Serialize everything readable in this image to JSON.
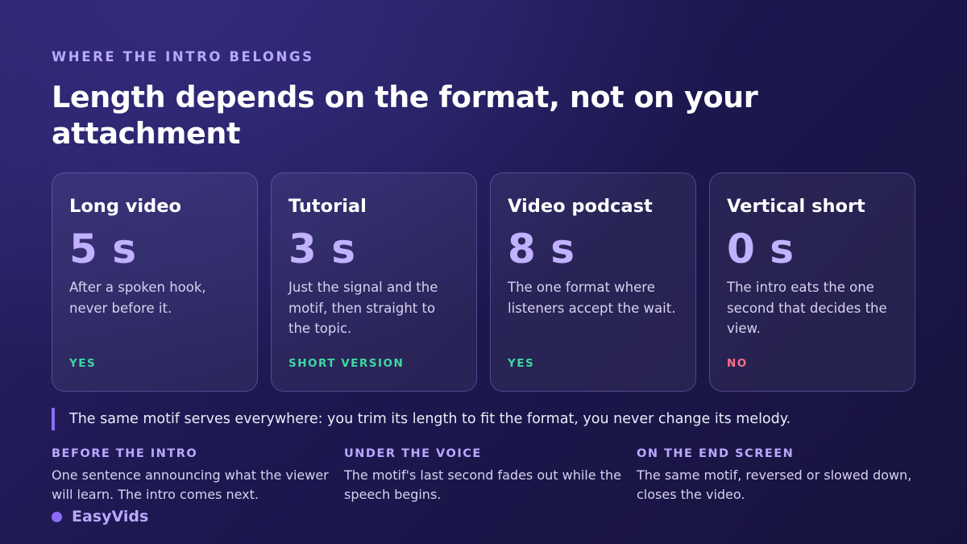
{
  "eyebrow": "WHERE THE INTRO BELONGS",
  "title": "Length depends on the format, not on your attachment",
  "cards": [
    {
      "name": "Long video",
      "value": "5 s",
      "desc": "After a spoken hook, never before it.",
      "status": "YES",
      "status_color": "#3ed8a0"
    },
    {
      "name": "Tutorial",
      "value": "3 s",
      "desc": "Just the signal and the motif, then straight to the topic.",
      "status": "SHORT VERSION",
      "status_color": "#3ed8a0"
    },
    {
      "name": "Video podcast",
      "value": "8 s",
      "desc": "The one format where listeners accept the wait.",
      "status": "YES",
      "status_color": "#3ed8a0"
    },
    {
      "name": "Vertical short",
      "value": "0 s",
      "desc": "The intro eats the one second that decides the view.",
      "status": "NO",
      "status_color": "#ff6b8a"
    }
  ],
  "quote": "The same motif serves everywhere: you trim its length to fit the format, you never change its melody.",
  "columns": [
    {
      "head": "BEFORE THE INTRO",
      "text": "One sentence announcing what the viewer will learn. The intro comes next."
    },
    {
      "head": "UNDER THE VOICE",
      "text": "The motif's last second fades out while the speech begins."
    },
    {
      "head": "ON THE END SCREEN",
      "text": "The same motif, reversed or slowed down, closes the video."
    }
  ],
  "brand": "EasyVids",
  "colors": {
    "accent": "#8b6cf6",
    "value": "#c1b2ff",
    "yes": "#3ed8a0",
    "no": "#ff6b8a"
  }
}
